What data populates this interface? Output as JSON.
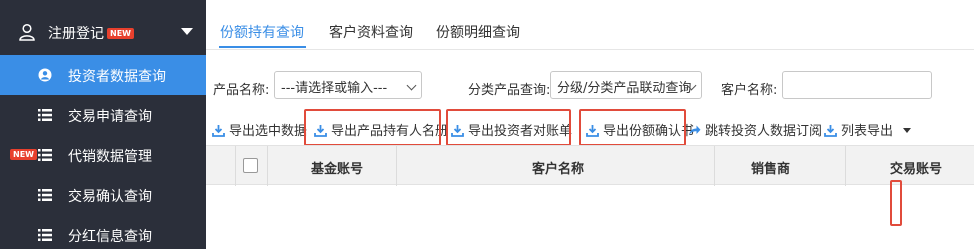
{
  "sidebar": {
    "header": {
      "label": "注册登记",
      "badge": "NEW",
      "icon": "user-icon"
    },
    "items": [
      {
        "label": "投资者数据查询",
        "icon": "user-circle-icon",
        "active": true
      },
      {
        "label": "交易申请查询",
        "icon": "list-icon"
      },
      {
        "label": "代销数据管理",
        "icon": "list-icon",
        "badge": "NEW"
      },
      {
        "label": "交易确认查询",
        "icon": "list-icon"
      },
      {
        "label": "分红信息查询",
        "icon": "list-icon"
      }
    ]
  },
  "tabs": [
    {
      "label": "份额持有查询",
      "active": true
    },
    {
      "label": "客户资料查询"
    },
    {
      "label": "份额明细查询"
    }
  ],
  "filters": {
    "product_label": "产品名称:",
    "product_value": "---请选择或输入---",
    "category_label": "分类产品查询:",
    "category_value": "分级/分类产品联动查询",
    "customer_label": "客户名称:",
    "customer_value": ""
  },
  "toolbar": [
    {
      "label": "导出选中数据",
      "icon": "download-icon"
    },
    {
      "label": "导出产品持有人名册",
      "icon": "download-icon",
      "highlighted": true
    },
    {
      "label": "导出投资者对账单",
      "icon": "download-icon",
      "highlighted": true
    },
    {
      "label": "导出份额确认书",
      "icon": "download-icon",
      "highlighted": true
    },
    {
      "label": "跳转投资人数据订阅",
      "icon": "share-arrow-icon"
    },
    {
      "label": "列表导出",
      "icon": "download-icon"
    }
  ],
  "table": {
    "columns": [
      "基金账号",
      "客户名称",
      "销售商",
      "交易账号"
    ]
  },
  "colors": {
    "sidebar_bg": "#2b2f3a",
    "accent": "#3a8ee6",
    "highlight": "#e14b3b",
    "badge": "#e8402d"
  }
}
